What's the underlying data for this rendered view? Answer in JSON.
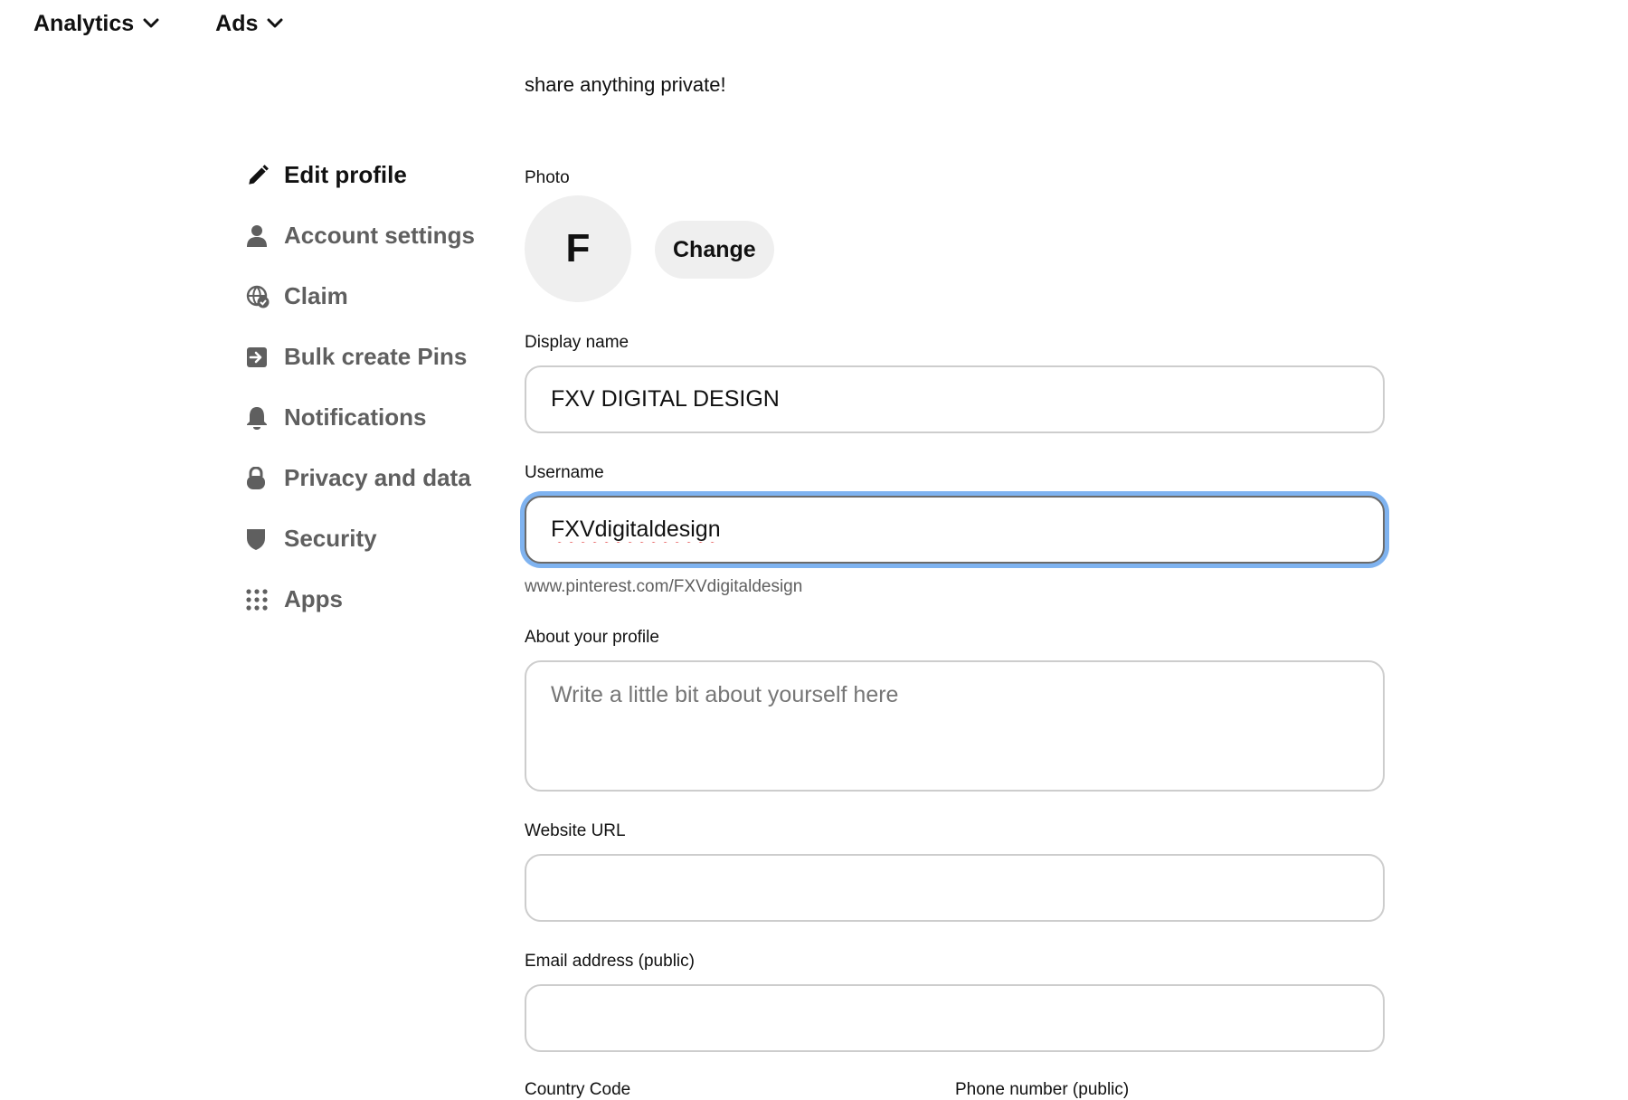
{
  "topnav": {
    "items": [
      {
        "label": "Analytics"
      },
      {
        "label": "Ads"
      }
    ]
  },
  "sidebar": {
    "items": [
      {
        "label": "Edit profile",
        "icon": "pencil-icon",
        "active": true
      },
      {
        "label": "Account settings",
        "icon": "person-icon"
      },
      {
        "label": "Claim",
        "icon": "globe-check-icon"
      },
      {
        "label": "Bulk create Pins",
        "icon": "import-icon"
      },
      {
        "label": "Notifications",
        "icon": "bell-icon"
      },
      {
        "label": "Privacy and data",
        "icon": "lock-icon"
      },
      {
        "label": "Security",
        "icon": "shield-icon"
      },
      {
        "label": "Apps",
        "icon": "grid-icon"
      }
    ]
  },
  "form": {
    "intro_text": "share anything private!",
    "photo": {
      "label": "Photo",
      "initial": "F",
      "change_label": "Change"
    },
    "display_name": {
      "label": "Display name",
      "value": "FXV DIGITAL DESIGN"
    },
    "username": {
      "label": "Username",
      "value": "FXVdigitaldesign",
      "helper": "www.pinterest.com/FXVdigitaldesign"
    },
    "about": {
      "label": "About your profile",
      "placeholder": "Write a little bit about yourself here"
    },
    "website": {
      "label": "Website URL",
      "value": ""
    },
    "email": {
      "label": "Email address (public)",
      "value": ""
    },
    "country_code": {
      "label": "Country Code"
    },
    "phone": {
      "label": "Phone number (public)"
    }
  },
  "colors": {
    "focus_ring": "#7fb3f0",
    "field_border": "#cdcdcd",
    "avatar_bg": "#efefef",
    "muted_text": "#5f5f5f"
  }
}
